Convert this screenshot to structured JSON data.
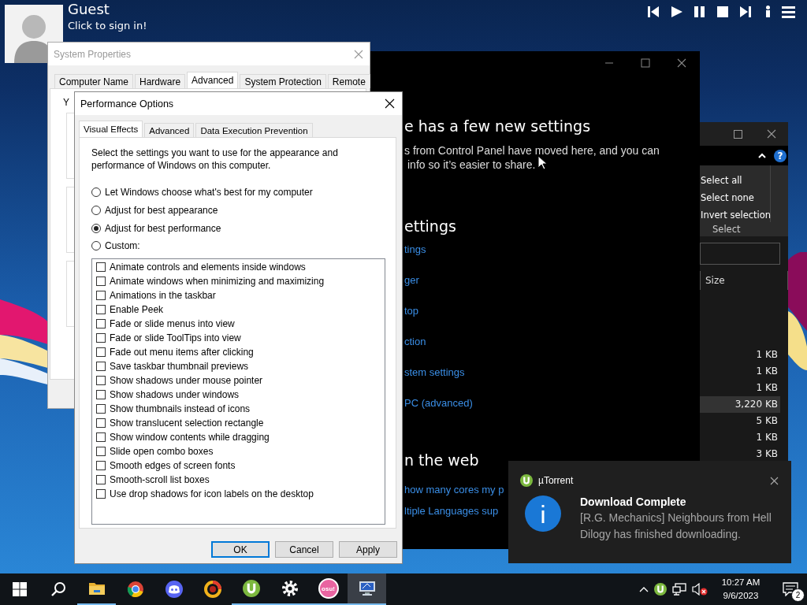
{
  "user_overlay": {
    "name": "Guest",
    "subtitle": "Click to sign in!"
  },
  "media_controls": [
    {
      "kind": "previous"
    },
    {
      "kind": "play"
    },
    {
      "kind": "pause"
    },
    {
      "kind": "stop"
    },
    {
      "kind": "next"
    },
    {
      "kind": "info"
    },
    {
      "kind": "menu"
    }
  ],
  "system_properties": {
    "title": "System Properties",
    "tabs": [
      {
        "label": "Computer Name",
        "selected": false
      },
      {
        "label": "Hardware",
        "selected": false
      },
      {
        "label": "Advanced",
        "selected": true
      },
      {
        "label": "System Protection",
        "selected": false
      },
      {
        "label": "Remote",
        "selected": false
      }
    ],
    "intro_fragment": "Y"
  },
  "settings_window": {
    "heading": "e has a few new settings",
    "text_lines": [
      "s from Control Panel have moved here, and you can",
      "info so it’s easier to share."
    ],
    "related_heading": "ettings",
    "related_links": [
      "tings",
      "ger",
      "top",
      "ction",
      "stem settings",
      "PC (advanced)"
    ],
    "web_heading": "n the web",
    "web_links": [
      "how many cores my p",
      "ltiple Languages sup"
    ]
  },
  "explorer_window": {
    "help_glyph": "?",
    "ribbon_commands": [
      "Select all",
      "Select none",
      "Invert selection"
    ],
    "ribbon_group": "Select",
    "column": "Size",
    "rows": [
      {
        "size": "1 KB",
        "selected": false
      },
      {
        "size": "1 KB",
        "selected": false
      },
      {
        "size": "1 KB",
        "selected": false
      },
      {
        "size": "3,220 KB",
        "selected": true
      },
      {
        "size": "5 KB",
        "selected": false
      },
      {
        "size": "1 KB",
        "selected": false
      },
      {
        "size": "3 KB",
        "selected": false
      }
    ]
  },
  "performance_options": {
    "title": "Performance Options",
    "tabs": [
      {
        "label": "Visual Effects",
        "selected": true
      },
      {
        "label": "Advanced",
        "selected": false
      },
      {
        "label": "Data Execution Prevention",
        "selected": false
      }
    ],
    "description": "Select the settings you want to use for the appearance and performance of Windows on this computer.",
    "modes": [
      {
        "label": "Let Windows choose what's best for my computer",
        "selected": false
      },
      {
        "label": "Adjust for best appearance",
        "selected": false
      },
      {
        "label": "Adjust for best performance",
        "selected": true
      },
      {
        "label": "Custom:",
        "selected": false
      }
    ],
    "effects": [
      {
        "label": "Animate controls and elements inside windows",
        "checked": false
      },
      {
        "label": "Animate windows when minimizing and maximizing",
        "checked": false
      },
      {
        "label": "Animations in the taskbar",
        "checked": false
      },
      {
        "label": "Enable Peek",
        "checked": false
      },
      {
        "label": "Fade or slide menus into view",
        "checked": false
      },
      {
        "label": "Fade or slide ToolTips into view",
        "checked": false
      },
      {
        "label": "Fade out menu items after clicking",
        "checked": false
      },
      {
        "label": "Save taskbar thumbnail previews",
        "checked": false
      },
      {
        "label": "Show shadows under mouse pointer",
        "checked": false
      },
      {
        "label": "Show shadows under windows",
        "checked": false
      },
      {
        "label": "Show thumbnails instead of icons",
        "checked": false
      },
      {
        "label": "Show translucent selection rectangle",
        "checked": false
      },
      {
        "label": "Show window contents while dragging",
        "checked": false
      },
      {
        "label": "Slide open combo boxes",
        "checked": false
      },
      {
        "label": "Smooth edges of screen fonts",
        "checked": false
      },
      {
        "label": "Smooth-scroll list boxes",
        "checked": false
      },
      {
        "label": "Use drop shadows for icon labels on the desktop",
        "checked": false
      }
    ],
    "buttons": [
      {
        "label": "OK",
        "default": true
      },
      {
        "label": "Cancel",
        "default": false
      },
      {
        "label": "Apply",
        "default": false
      }
    ]
  },
  "notification": {
    "app": "µTorrent",
    "title": "Download Complete",
    "body": "[R.G. Mechanics] Neighbours from Hell Dilogy has finished downloading."
  },
  "taskbar": {
    "items": [
      {
        "kind": "start",
        "running": false,
        "active": false
      },
      {
        "kind": "search",
        "running": false,
        "active": false
      },
      {
        "kind": "folder",
        "running": true,
        "active": false
      },
      {
        "kind": "browser",
        "running": false,
        "active": false
      },
      {
        "kind": "chat",
        "running": false,
        "active": false
      },
      {
        "kind": "ring",
        "running": false,
        "active": false
      },
      {
        "kind": "torrent",
        "running": true,
        "active": false
      },
      {
        "kind": "gear",
        "running": true,
        "active": false
      },
      {
        "kind": "osu",
        "label": "osu!",
        "running": true,
        "active": false
      },
      {
        "kind": "computer",
        "running": true,
        "active": true
      }
    ],
    "tray": {
      "volume_muted": true,
      "time": "10:27 AM",
      "date": "9/6/2023",
      "notification_count": "2"
    }
  }
}
